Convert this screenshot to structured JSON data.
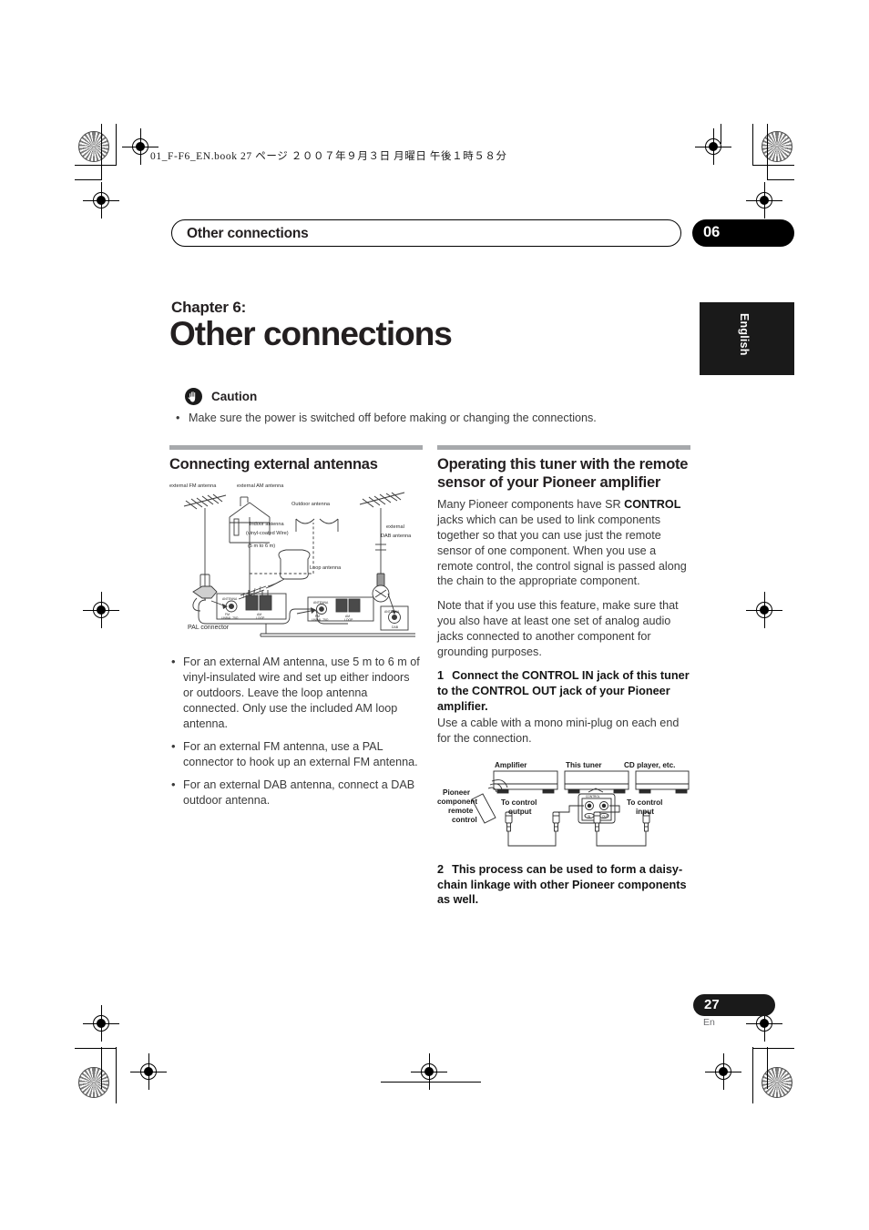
{
  "print_marks": {
    "file_info": "01_F-F6_EN.book    27 ページ    ２００７年９月３日    月曜日    午後１時５８分"
  },
  "running_head": {
    "title": "Other connections",
    "chapter_number": "06"
  },
  "language_tab": {
    "label": "English"
  },
  "chapter": {
    "label": "Chapter 6:",
    "title": "Other connections"
  },
  "caution": {
    "icon": "hand-stop-icon",
    "label": "Caution",
    "bullet": "Make sure the power is switched off before making or changing the connections."
  },
  "left_column": {
    "heading": "Connecting external antennas",
    "figure": {
      "name": "external-antenna-connection-diagram",
      "labels": {
        "external_fm": "external FM antenna",
        "external_am": "external AM antenna",
        "outdoor": "Outdoor antenna",
        "indoor_1": "Indoor antenna",
        "indoor_2": "(vinyl-coated Wire)",
        "indoor_3": "(5 m to 6 m)",
        "loop": "Loop antenna",
        "external_dab_1": "external",
        "external_dab_2": "DAB antenna",
        "pal": "PAL connector",
        "jack_panel_1": "ANTENNA",
        "jack_panel_2": "ANTENNA",
        "jack_fm_1": "FM",
        "jack_fm_2": "UNBAL 75Ω",
        "jack_am_1": "AM",
        "jack_am_2": "LOOP",
        "jack_dab_1": "ANTENNA",
        "jack_dab_2": "DAB"
      }
    },
    "bullets": [
      "For an external AM antenna, use 5 m to 6 m of vinyl-insulated wire and set up either indoors or outdoors. Leave the loop antenna connected. Only use the included AM loop antenna.",
      "For an external FM antenna, use a PAL connector to hook up an external FM antenna.",
      "For an external DAB antenna, connect a DAB outdoor antenna."
    ]
  },
  "right_column": {
    "heading": "Operating this tuner with the remote sensor of your Pioneer amplifier",
    "paragraphs": [
      "Many Pioneer components have SR CONTROL jacks which can be used to link components together so that you can use just the remote sensor of one component. When you use a remote control, the control signal is passed along the chain to the appropriate component.",
      "Note that if you use this feature, make sure that you also have at least one set of analog audio jacks connected to another component for grounding purposes."
    ],
    "paragraph_1_bold_term": "CONTROL",
    "steps": [
      {
        "number": "1",
        "bold_text": "Connect the CONTROL IN jack of this tuner to the CONTROL OUT jack of your Pioneer amplifier.",
        "body_text": "Use a cable with a mono mini-plug on each end for the connection."
      },
      {
        "number": "2",
        "bold_text": "This process can be used to form a daisy-chain linkage with other Pioneer components as well.",
        "body_text": ""
      }
    ],
    "figure": {
      "name": "control-daisy-chain-diagram",
      "labels": {
        "amplifier": "Amplifier",
        "this_tuner": "This tuner",
        "cd_player": "CD player, etc.",
        "remote_1": "Pioneer",
        "remote_2": "component",
        "remote_3": "remote",
        "remote_4": "control",
        "to_control_output_1": "To control",
        "to_control_output_2": "output",
        "to_control_input_1": "To control",
        "to_control_input_2": "input",
        "control_panel": "CONTROL",
        "jack_in": "IN",
        "jack_out": "OUT"
      }
    }
  },
  "footer": {
    "page_number": "27",
    "language_code": "En"
  },
  "colors": {
    "ink": "#231f20",
    "rule_gray": "#a7a9ac",
    "body_gray": "#3a3a3a",
    "black_tab": "#1a1a1a"
  }
}
